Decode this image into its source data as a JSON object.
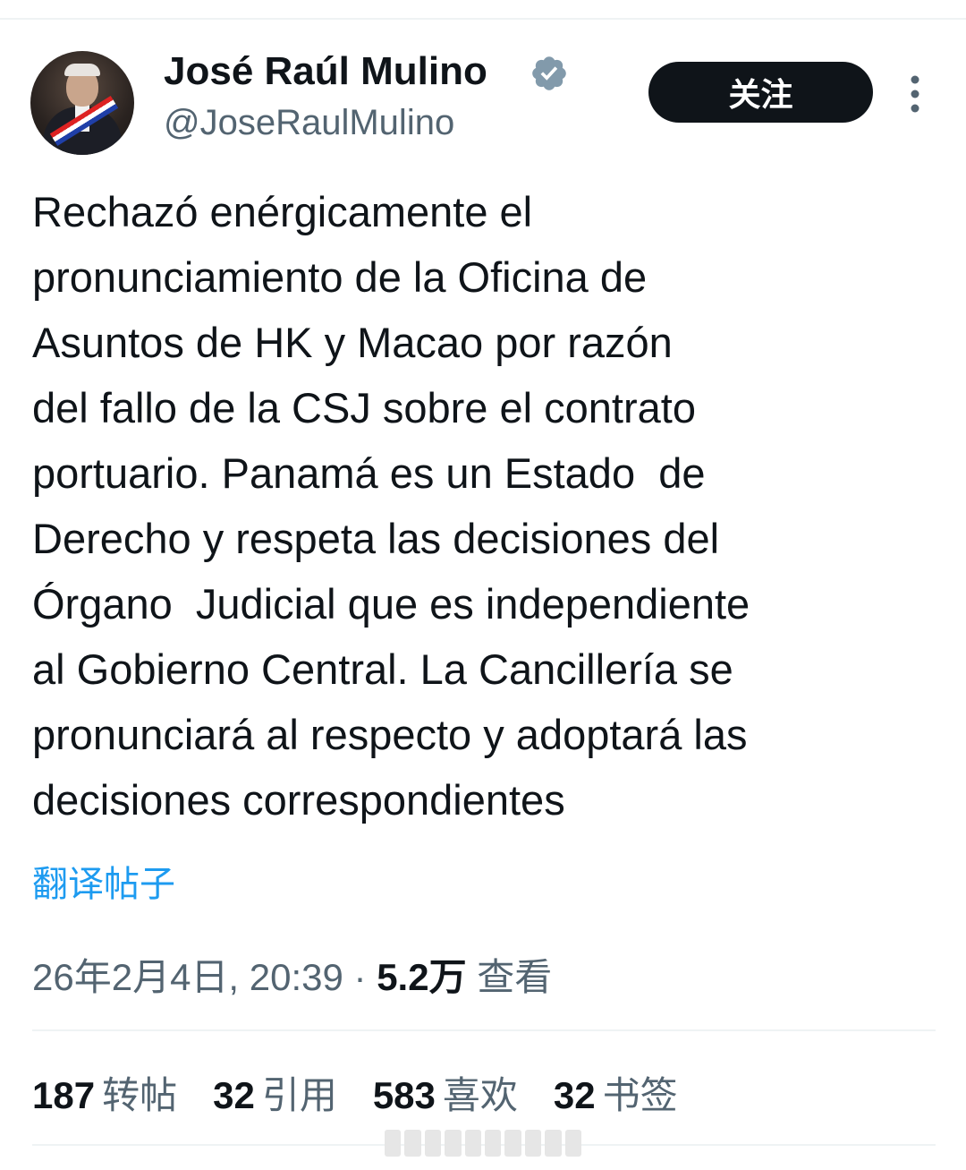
{
  "author": {
    "name": "José Raúl Mulino",
    "handle": "@JoseRaulMulino",
    "verified_icon": "verified-badge-icon"
  },
  "follow_button": {
    "label": "关注"
  },
  "tweet": {
    "text": "Rechazó enérgicamente el\npronunciamiento de la Oficina de\nAsuntos de HK y Macao por razón\ndel fallo de la CSJ sobre el contrato\nportuario. Panamá es un Estado  de\nDerecho y respeta las decisiones del\nÓrgano  Judicial que es independiente\nal Gobierno Central. La Cancillería se\npronunciará al respecto y adoptará las\ndecisiones correspondientes"
  },
  "translate_link": "翻译帖子",
  "meta": {
    "timestamp": "26年2月4日, 20:39",
    "separator": " · ",
    "views_count": "5.2万",
    "views_label": " 查看"
  },
  "stats": [
    {
      "count": "187",
      "label": "转帖"
    },
    {
      "count": "32",
      "label": "引用"
    },
    {
      "count": "583",
      "label": "喜欢"
    },
    {
      "count": "32",
      "label": "书签"
    }
  ],
  "colors": {
    "text_primary": "#0f1419",
    "text_secondary": "#536471",
    "link": "#1d9bf0",
    "follow_bg": "#0f1419"
  }
}
